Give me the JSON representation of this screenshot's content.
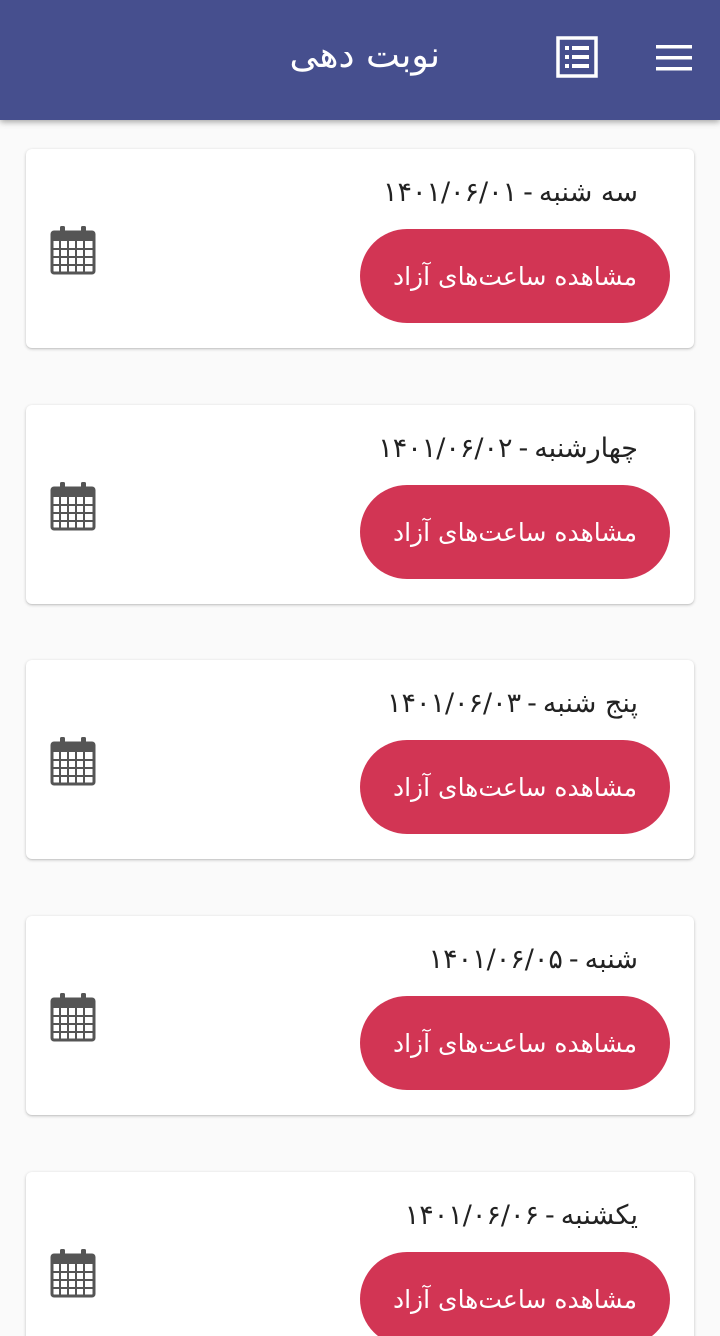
{
  "appbar": {
    "title": "نوبت دهی",
    "list_icon": "list-icon",
    "menu_icon": "hamburger-menu-icon",
    "color": "#464f8e"
  },
  "accent_color": "#d23554",
  "days": [
    {
      "day": "سه شنبه",
      "date": "۱۴۰۱/۰۶/۰۱",
      "button": "مشاهده ساعت‌های آزاد",
      "icon": "calendar-icon"
    },
    {
      "day": "چهارشنبه",
      "date": "۱۴۰۱/۰۶/۰۲",
      "button": "مشاهده ساعت‌های آزاد",
      "icon": "calendar-icon"
    },
    {
      "day": "پنج شنبه",
      "date": "۱۴۰۱/۰۶/۰۳",
      "button": "مشاهده ساعت‌های آزاد",
      "icon": "calendar-icon"
    },
    {
      "day": "شنبه",
      "date": "۱۴۰۱/۰۶/۰۵",
      "button": "مشاهده ساعت‌های آزاد",
      "icon": "calendar-icon"
    },
    {
      "day": "یکشنبه",
      "date": "۱۴۰۱/۰۶/۰۶",
      "button": "مشاهده ساعت‌های آزاد",
      "icon": "calendar-icon"
    }
  ]
}
